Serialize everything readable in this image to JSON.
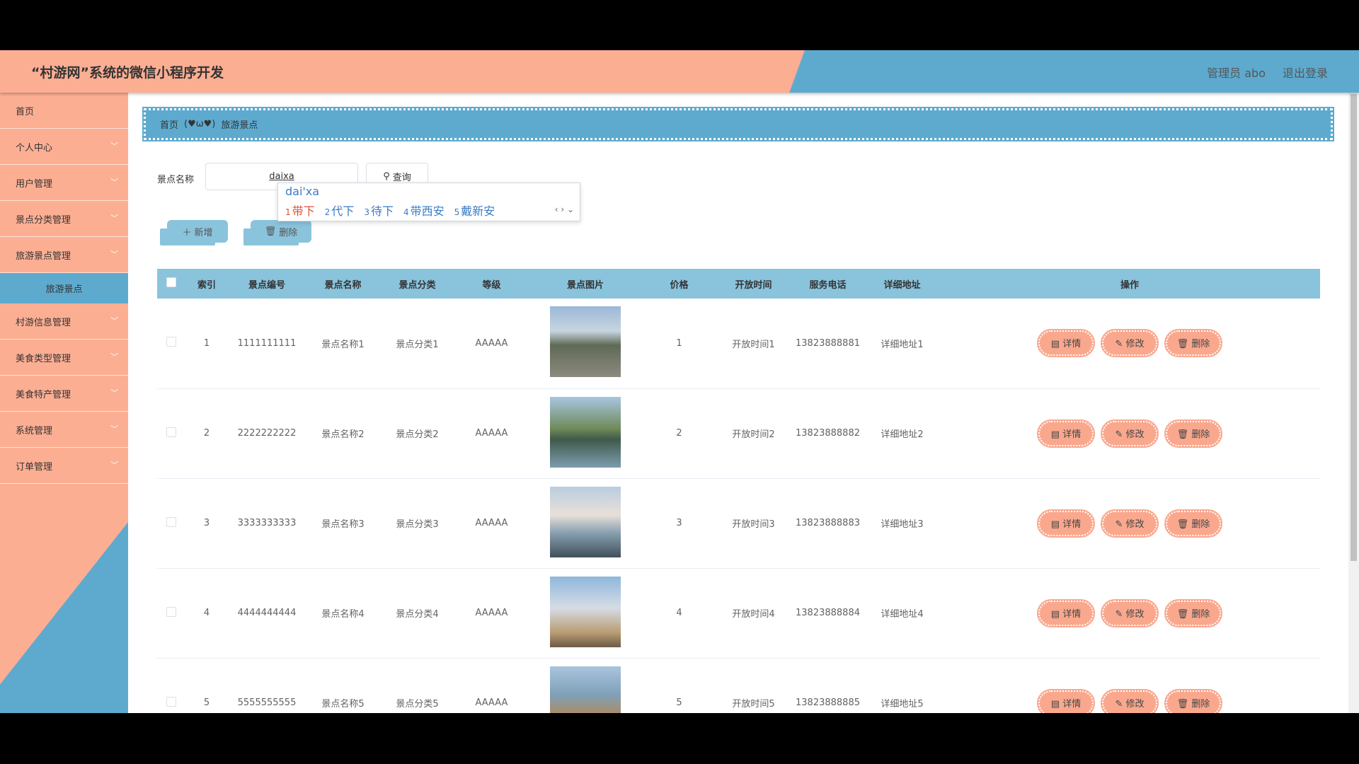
{
  "header": {
    "title": "“村游网”系统的微信小程序开发",
    "user": "管理员 abo",
    "logout": "退出登录"
  },
  "sidebar": {
    "items": [
      {
        "label": "首页"
      },
      {
        "label": "个人中心"
      },
      {
        "label": "用户管理"
      },
      {
        "label": "景点分类管理"
      },
      {
        "label": "旅游景点管理"
      }
    ],
    "active_sub": "旅游景点",
    "items2": [
      {
        "label": "村游信息管理"
      },
      {
        "label": "美食类型管理"
      },
      {
        "label": "美食特产管理"
      },
      {
        "label": "系统管理"
      },
      {
        "label": "订单管理"
      }
    ]
  },
  "breadcrumb": {
    "home": "首页",
    "sep": "(♥ω♥)",
    "current": "旅游景点"
  },
  "search": {
    "label": "景点名称",
    "value": "daixa",
    "button": "查询"
  },
  "ime": {
    "composition": "dai'xa",
    "candidates": [
      {
        "n": "1",
        "t": "带下"
      },
      {
        "n": "2",
        "t": "代下"
      },
      {
        "n": "3",
        "t": "待下"
      },
      {
        "n": "4",
        "t": "带西安"
      },
      {
        "n": "5",
        "t": "戴新安"
      }
    ]
  },
  "actions": {
    "add": "新增",
    "delete": "删除"
  },
  "table": {
    "columns": [
      "索引",
      "景点编号",
      "景点名称",
      "景点分类",
      "等级",
      "景点图片",
      "价格",
      "开放时间",
      "服务电话",
      "详细地址",
      "操作"
    ],
    "rows": [
      {
        "idx": "1",
        "code": "1111111111",
        "name": "景点名称1",
        "cat": "景点分类1",
        "level": "AAAAA",
        "price": "1",
        "open": "开放时间1",
        "phone": "13823888881",
        "addr": "详细地址1"
      },
      {
        "idx": "2",
        "code": "2222222222",
        "name": "景点名称2",
        "cat": "景点分类2",
        "level": "AAAAA",
        "price": "2",
        "open": "开放时间2",
        "phone": "13823888882",
        "addr": "详细地址2"
      },
      {
        "idx": "3",
        "code": "3333333333",
        "name": "景点名称3",
        "cat": "景点分类3",
        "level": "AAAAA",
        "price": "3",
        "open": "开放时间3",
        "phone": "13823888883",
        "addr": "详细地址3"
      },
      {
        "idx": "4",
        "code": "4444444444",
        "name": "景点名称4",
        "cat": "景点分类4",
        "level": "AAAAA",
        "price": "4",
        "open": "开放时间4",
        "phone": "13823888884",
        "addr": "详细地址4"
      },
      {
        "idx": "5",
        "code": "5555555555",
        "name": "景点名称5",
        "cat": "景点分类5",
        "level": "AAAAA",
        "price": "5",
        "open": "开放时间5",
        "phone": "13823888885",
        "addr": "详细地址5"
      }
    ],
    "ops": {
      "detail": "详情",
      "edit": "修改",
      "delete": "删除"
    }
  }
}
